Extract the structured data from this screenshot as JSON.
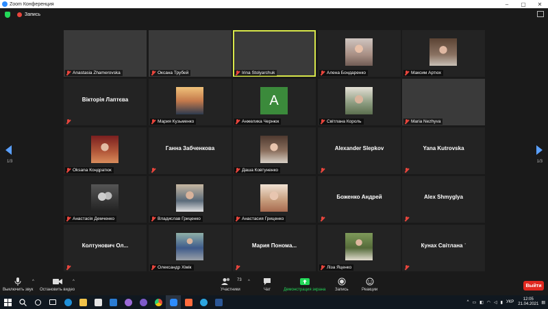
{
  "window": {
    "title": "Zoom Конференция"
  },
  "info": {
    "recording_label": "Запись"
  },
  "tiles": [
    {
      "name": "Anastasia Zhamerovska",
      "kind": "video",
      "photo": "ph-big-a"
    },
    {
      "name": "Оксана Трубей",
      "kind": "video",
      "photo": "ph-big-b"
    },
    {
      "name": "Irina Stolyarchuk",
      "kind": "video",
      "photo": "ph-big-c",
      "active": true
    },
    {
      "name": "Алена Бондаренко",
      "kind": "thumb",
      "photo": "ph-a"
    },
    {
      "name": "Максим Артюх",
      "kind": "thumb",
      "photo": "ph-d"
    },
    {
      "name": "Вікторія Лаптєва",
      "kind": "text"
    },
    {
      "name": "Мария Кузьменко",
      "kind": "thumb",
      "photo": "ph-f"
    },
    {
      "name": "Анжелика Чернюк",
      "kind": "letter",
      "letter": "A"
    },
    {
      "name": "Світлана Король",
      "kind": "thumb",
      "photo": "ph-e"
    },
    {
      "name": "Maria Nezhyva",
      "kind": "video",
      "photo": "ph-big-d"
    },
    {
      "name": "Oksana Кондратюк",
      "kind": "thumb",
      "photo": "ph-i"
    },
    {
      "name": "Ганна Забченкова",
      "kind": "text"
    },
    {
      "name": "Даша Ковтуненко",
      "kind": "thumb",
      "photo": "ph-j"
    },
    {
      "name": "Alexander Slepkov",
      "kind": "text"
    },
    {
      "name": "Yana Kutrovska",
      "kind": "text"
    },
    {
      "name": "Анастасія Демченко",
      "kind": "thumb",
      "photo": "ph-k"
    },
    {
      "name": "Владислав Гриценко",
      "kind": "thumb",
      "photo": "ph-l"
    },
    {
      "name": "Анастасия Гриценко",
      "kind": "thumb",
      "photo": "ph-m"
    },
    {
      "name": "Боженко Андрей",
      "kind": "text"
    },
    {
      "name": "Alex Shmyglya",
      "kind": "text"
    },
    {
      "name": "Колтунович Ол...",
      "kind": "text"
    },
    {
      "name": "Олександр Хімік",
      "kind": "thumb",
      "photo": "ph-n"
    },
    {
      "name": "Мария Пономa...",
      "kind": "text"
    },
    {
      "name": "Ліза Яценко",
      "kind": "thumb",
      "photo": "ph-o"
    },
    {
      "name": "Кунах Світлана ˈ",
      "kind": "text"
    }
  ],
  "pager": {
    "left": "1/3",
    "right": "1/3"
  },
  "toolbar": {
    "mute": "Выключить звук",
    "video": "Остановить видео",
    "participants": "Участники",
    "participants_count": "73",
    "chat": "Чат",
    "share": "Демонстрация экрана",
    "record": "Запись",
    "reactions": "Реакции",
    "end": "Выйти",
    "share_color": "#23d959",
    "end_color": "#e0281f"
  },
  "taskbar": {
    "lang": "УКР",
    "time": "12:05",
    "date": "21.04.2021"
  }
}
